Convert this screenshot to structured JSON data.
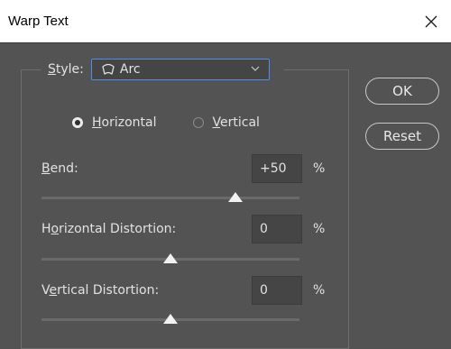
{
  "window": {
    "title": "Warp Text",
    "close_icon": "close-icon"
  },
  "style": {
    "label_prefix": "",
    "label_mnemonic": "S",
    "label_rest": "tyle:",
    "selected": "Arc",
    "icon": "arc-warp-icon"
  },
  "orientation": {
    "horizontal": {
      "mnemonic": "H",
      "rest": "orizontal",
      "selected": true
    },
    "vertical": {
      "mnemonic": "V",
      "rest": "ertical",
      "selected": false
    }
  },
  "bend": {
    "mnemonic": "B",
    "rest": "end:",
    "value": "+50",
    "unit": "%",
    "slider_fraction": 0.75
  },
  "horizontal_distortion": {
    "pre": "H",
    "mnemonic": "o",
    "rest": "rizontal Distortion:",
    "value": "0",
    "unit": "%",
    "slider_fraction": 0.5
  },
  "vertical_distortion": {
    "pre": "V",
    "mnemonic": "e",
    "rest": "rtical Distortion:",
    "value": "0",
    "unit": "%",
    "slider_fraction": 0.5
  },
  "buttons": {
    "ok": "OK",
    "reset": "Reset"
  }
}
